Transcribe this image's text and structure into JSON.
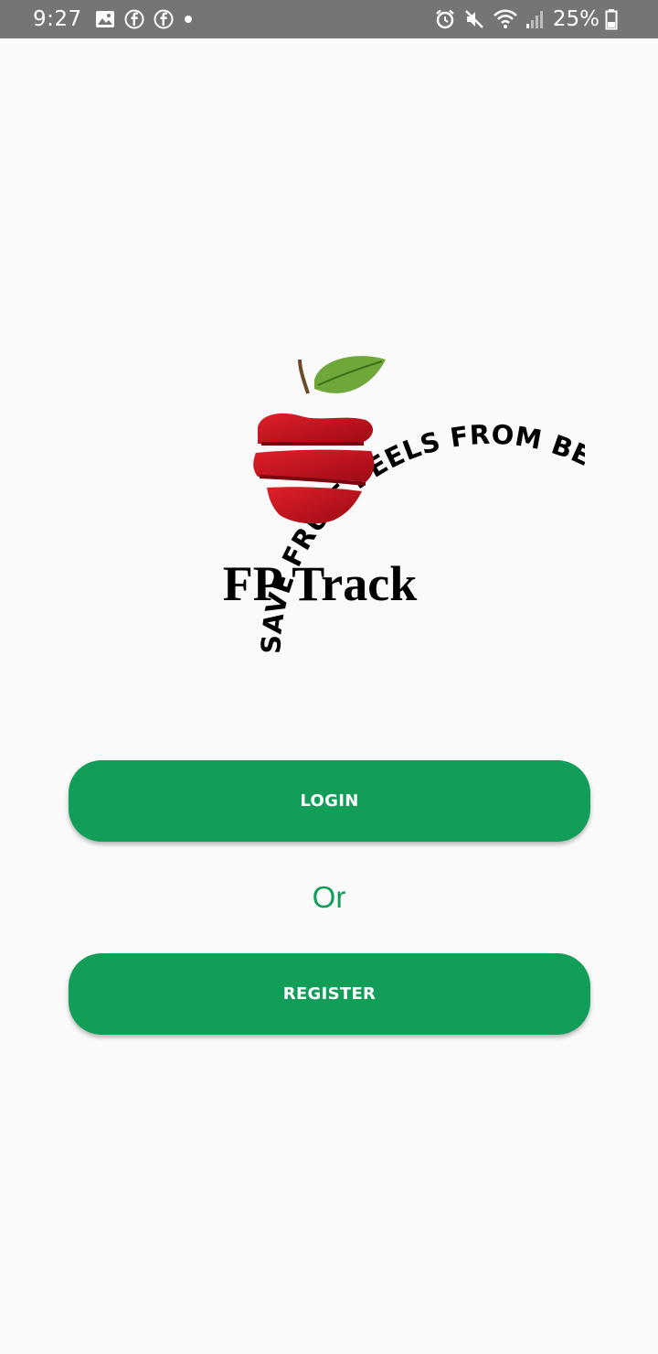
{
  "status_bar": {
    "time": "9:27",
    "battery": "25%",
    "icons_left": [
      "image-icon",
      "facebook-icon",
      "facebook-icon",
      "dot-icon"
    ],
    "icons_right": [
      "alarm-icon",
      "mute-icon",
      "wifi-icon",
      "signal-icon",
      "battery-icon"
    ]
  },
  "logo": {
    "ring_text": "SAVE FRUIT PEELS FROM BEING WASTED.SAVE FRUIT PEELS FROM BEING WASTED.",
    "app_name": "FP Track"
  },
  "buttons": {
    "login_label": "LOGIN",
    "register_label": "REGISTER"
  },
  "separator_text": "Or",
  "colors": {
    "accent_green": "#129d59",
    "status_bar_bg": "#757575",
    "background": "#fafafa",
    "apple_red": "#d2131e",
    "leaf_green": "#6fa83a"
  }
}
